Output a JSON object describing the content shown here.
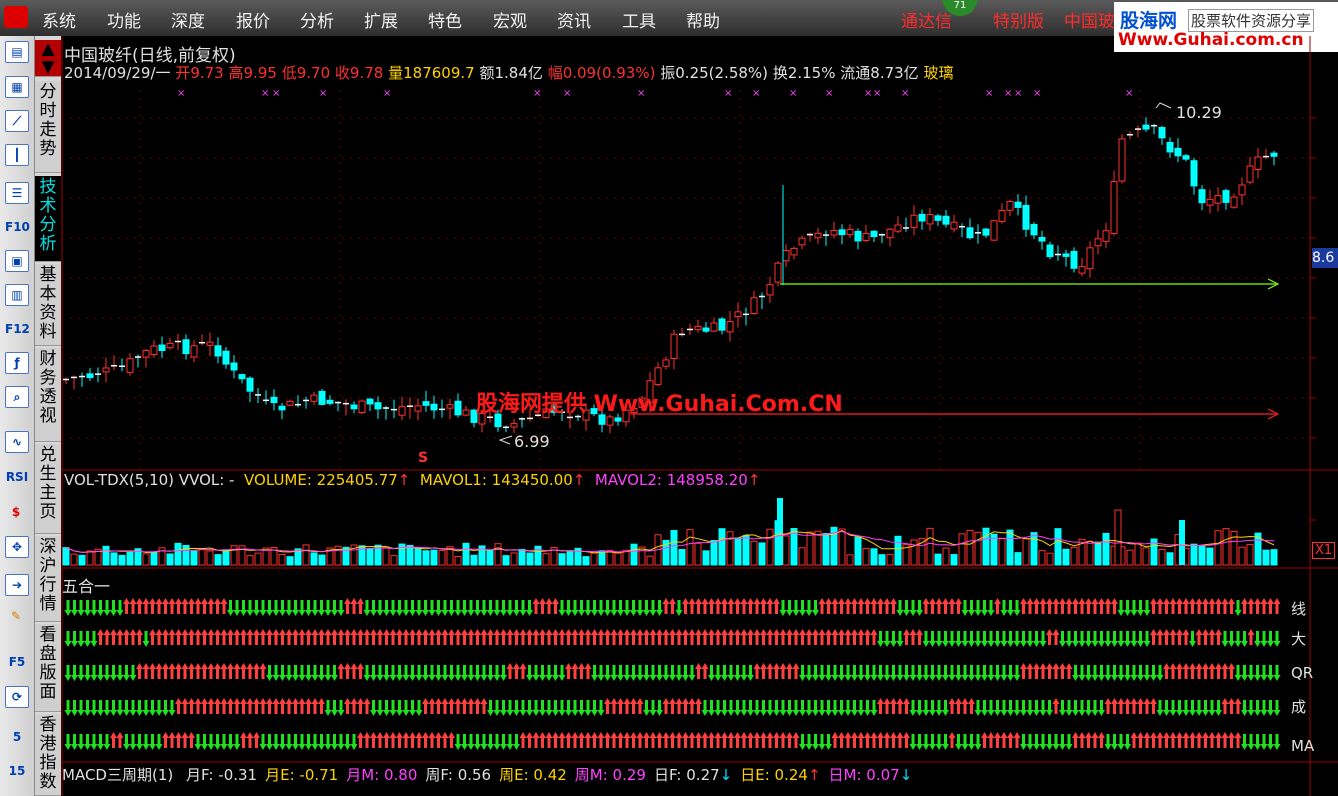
{
  "menubar": {
    "items": [
      "系统",
      "功能",
      "深度",
      "报价",
      "分析",
      "扩展",
      "特色",
      "宏观",
      "资讯",
      "工具",
      "帮助"
    ],
    "promo1": "通达信",
    "promo1b": "特别版",
    "promo2": "中国玻",
    "badge": "71"
  },
  "logo": {
    "line1": "股海网",
    "line1b": "股票软件资源分享",
    "line2": "Www.Guhai.com.cn"
  },
  "watermark": "股海网提供 Www.Guhai.Com.CN",
  "toolbar": {
    "items": [
      "chart-icon",
      "table-icon",
      "line-icon",
      "candle-icon",
      "list-icon",
      "F10",
      "window-icon",
      "book-icon",
      "F12",
      "fx-icon",
      "search-icon",
      "wave-icon",
      "RSI",
      "dollar-icon",
      "move-icon",
      "arrow-icon",
      "pen-icon",
      "F5",
      "refresh-icon",
      "5",
      "15"
    ]
  },
  "tabs": [
    "分时走势",
    "技术分析",
    "基本资料",
    "财务透视",
    "兑生主页",
    "深沪行情",
    "看盘版面",
    "香港指数"
  ],
  "header": {
    "title": "中国玻纤(日线,前复权)",
    "date": "2014/09/29/一",
    "open_label": "开",
    "open": "9.73",
    "high_label": "高",
    "high": "9.95",
    "low_label": "低",
    "low": "9.70",
    "close_label": "收",
    "close": "9.78",
    "vol_label": "量",
    "vol": "187609.7",
    "amt_label": "额",
    "amt": "1.84亿",
    "chg_label": "幅",
    "chg": "0.09(0.93%)",
    "amp_label": "振",
    "amp": "0.25(2.58%)",
    "turn_label": "换",
    "turn": "2.15%",
    "float_label": "流通",
    "float": "8.73亿",
    "sector": "玻璃"
  },
  "price_panel": {
    "high_label": "10.29",
    "low_label": "6.99",
    "right_label": "8.6",
    "s_marker": "S"
  },
  "volume_panel": {
    "name": "VOL-TDX(5,10)",
    "vvol": "VVOL: -",
    "volume_label": "VOLUME: 225405.77",
    "mavol1_label": "MAVOL1: 143450.00",
    "mavol2_label": "MAVOL2: 148958.20",
    "right_label": "X1"
  },
  "signal_panel": {
    "title": "五合一",
    "rows": [
      "线",
      "大",
      "QR",
      "成",
      "MA"
    ]
  },
  "macd_panel": {
    "name": "MACD三周期(1)",
    "items": [
      {
        "label": "月F: -0.31",
        "color": "#e0e0e0",
        "arrow": ""
      },
      {
        "label": "月E: -0.71",
        "color": "#ffd200",
        "arrow": ""
      },
      {
        "label": "月M: 0.80",
        "color": "#ff40ff",
        "arrow": ""
      },
      {
        "label": "周F: 0.56",
        "color": "#e0e0e0",
        "arrow": ""
      },
      {
        "label": "周E: 0.42",
        "color": "#ffd200",
        "arrow": ""
      },
      {
        "label": "周M: 0.29",
        "color": "#ff40ff",
        "arrow": ""
      },
      {
        "label": "日F: 0.27",
        "color": "#e0e0e0",
        "arrow": "↓"
      },
      {
        "label": "日E: 0.24",
        "color": "#ffd200",
        "arrow": "↑"
      },
      {
        "label": "日M: 0.07",
        "color": "#ff40ff",
        "arrow": "↓"
      }
    ]
  },
  "colors": {
    "up": "#ff3030",
    "down": "#00ffff",
    "green": "#00e000",
    "magenta": "#ff40ff",
    "yellow": "#ffd200"
  }
}
